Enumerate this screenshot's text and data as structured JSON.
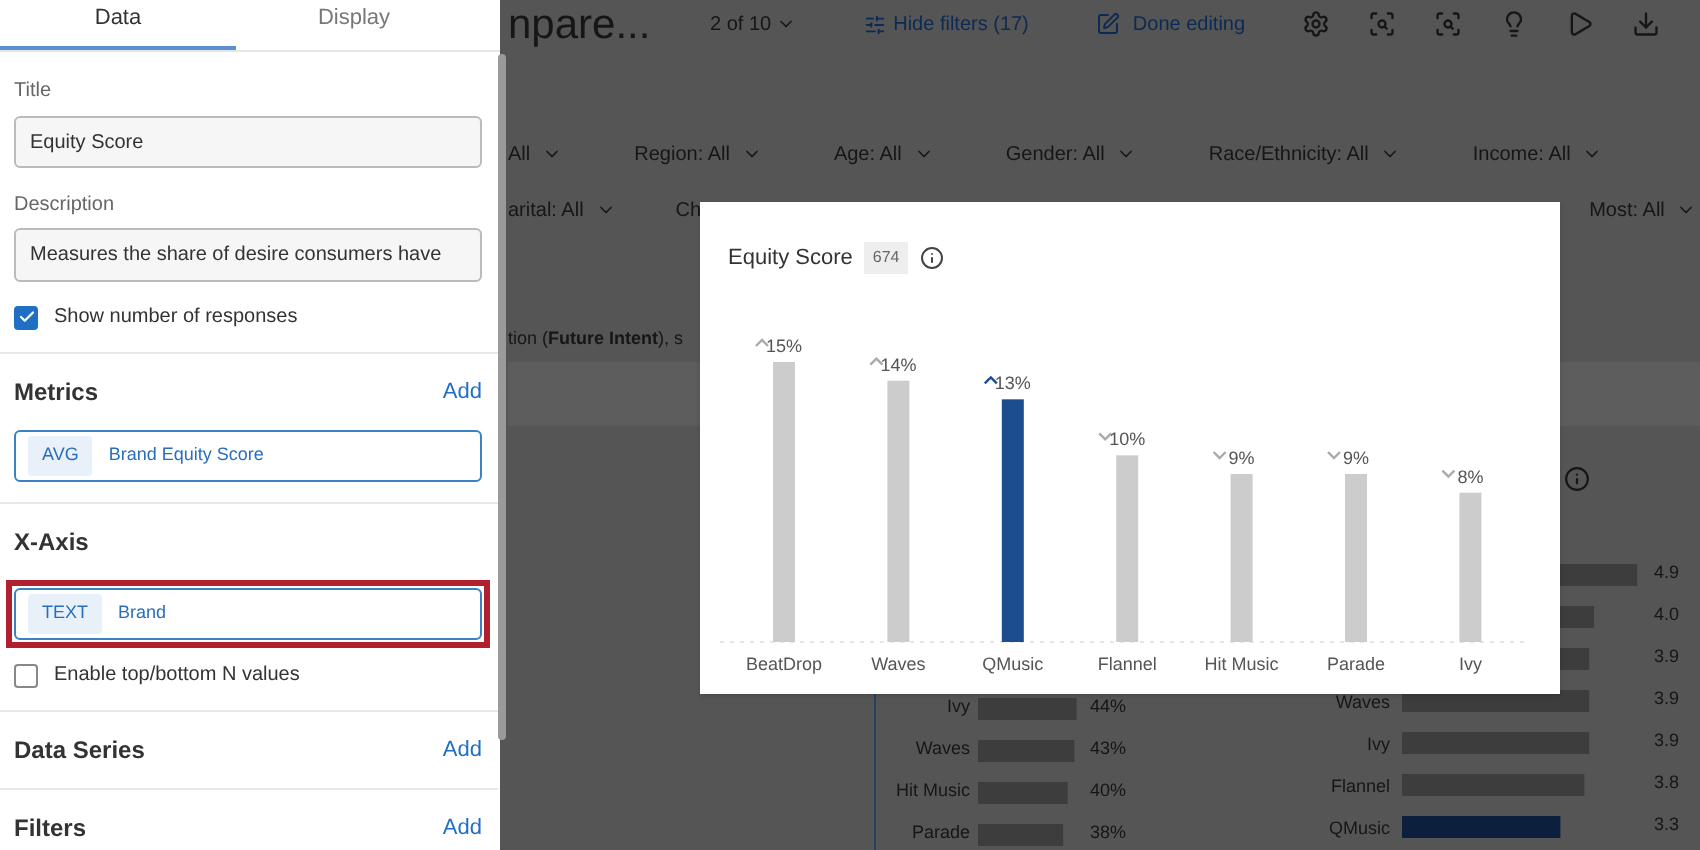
{
  "sidebar": {
    "tabs": [
      {
        "label": "Data",
        "selected": true
      },
      {
        "label": "Display",
        "selected": false
      }
    ],
    "title_field": {
      "label": "Title",
      "value": "Equity Score"
    },
    "description_field": {
      "label": "Description",
      "value": "Measures the share of desire consumers have"
    },
    "show_responses": {
      "label": "Show number of responses",
      "checked": true
    },
    "sections": [
      {
        "heading": "Metrics",
        "action": "Add",
        "field": {
          "tag": "AVG",
          "label": "Brand Equity Score",
          "highlighted": false
        }
      },
      {
        "heading": "X-Axis",
        "field": {
          "tag": "TEXT",
          "label": "Brand",
          "highlighted": true
        },
        "option": {
          "label": "Enable top/bottom N values",
          "checked": false
        }
      },
      {
        "heading": "Data Series",
        "action": "Add"
      },
      {
        "heading": "Filters",
        "action": "Add"
      }
    ]
  },
  "toolbar": {
    "title": "npare...",
    "page": "2 of 10",
    "hide_filters": "Hide filters (17)",
    "done": "Done editing"
  },
  "filters": [
    [
      "All",
      "Region: All",
      "Age: All",
      "Gender: All",
      "Race/Ethnicity: All",
      "Income: All"
    ],
    [
      "arital: All",
      "Ch",
      "Most: All"
    ]
  ],
  "subtitle": "tion (**Future Intent**), s",
  "back_left": [
    {
      "label": "Ivy",
      "value": "44%",
      "level": 0.44
    },
    {
      "label": "Waves",
      "value": "43%",
      "level": 0.43
    },
    {
      "label": "Hit Music",
      "value": "40%",
      "level": 0.4
    },
    {
      "label": "Parade",
      "value": "38%",
      "level": 0.38
    }
  ],
  "back_right": [
    {
      "value": "4.9",
      "level": 0.98,
      "selected": false
    },
    {
      "value": "4.0",
      "level": 0.8,
      "selected": false
    },
    {
      "value": "3.9",
      "level": 0.78,
      "selected": false
    },
    {
      "label": "Waves",
      "value": "3.9",
      "level": 0.78,
      "selected": false
    },
    {
      "label": "Ivy",
      "value": "3.9",
      "level": 0.78,
      "selected": false
    },
    {
      "label": "Flannel",
      "value": "3.8",
      "level": 0.76,
      "selected": false
    },
    {
      "label": "QMusic",
      "value": "3.3",
      "level": 0.66,
      "selected": true
    }
  ],
  "chart_card": {
    "count": "674",
    "trend_up": [
      true,
      true,
      true,
      false,
      false,
      false,
      false
    ],
    "chart_data": {
      "type": "bar",
      "title": "Equity Score",
      "categories": [
        "BeatDrop",
        "Waves",
        "QMusic",
        "Flannel",
        "Hit Music",
        "Parade",
        "Ivy"
      ],
      "series": [
        {
          "color": "#cccccc",
          "values": [
            15,
            14,
            null,
            10,
            9,
            9,
            8
          ],
          "value_labels": [
            "15%",
            "14%",
            null,
            "10%",
            "9%",
            "9%",
            "8%"
          ]
        },
        {
          "color": "#1c4d8c",
          "values": [
            null,
            null,
            13,
            null,
            null,
            null,
            null
          ],
          "value_labels": [
            null,
            null,
            "13%",
            null,
            null,
            null,
            null
          ]
        }
      ]
    }
  }
}
